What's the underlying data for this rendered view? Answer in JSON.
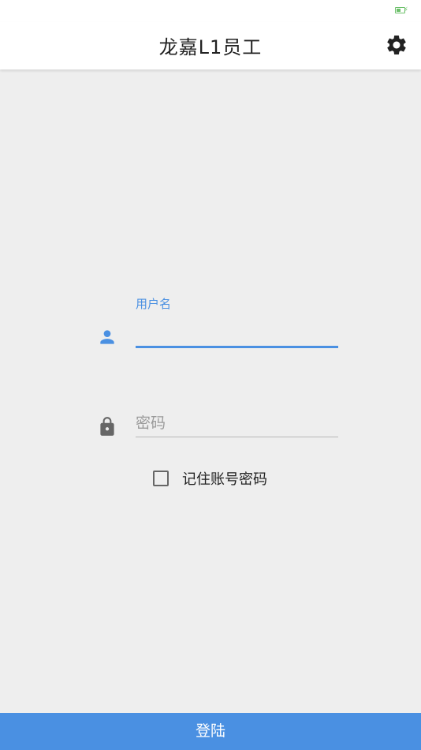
{
  "status_bar": {
    "battery_color": "#6cc06a",
    "battery_icon": "battery-charging-icon"
  },
  "app_bar": {
    "title": "龙嘉L1员工",
    "settings_icon": "gear-icon"
  },
  "form": {
    "username": {
      "label": "用户名",
      "value": "",
      "icon": "person-icon",
      "accent_color": "#4a90e2"
    },
    "password": {
      "placeholder": "密码",
      "value": "",
      "icon": "lock-icon"
    },
    "remember": {
      "label": "记住账号密码",
      "checked": false
    }
  },
  "login_button": {
    "label": "登陆",
    "color": "#4a90e2"
  }
}
